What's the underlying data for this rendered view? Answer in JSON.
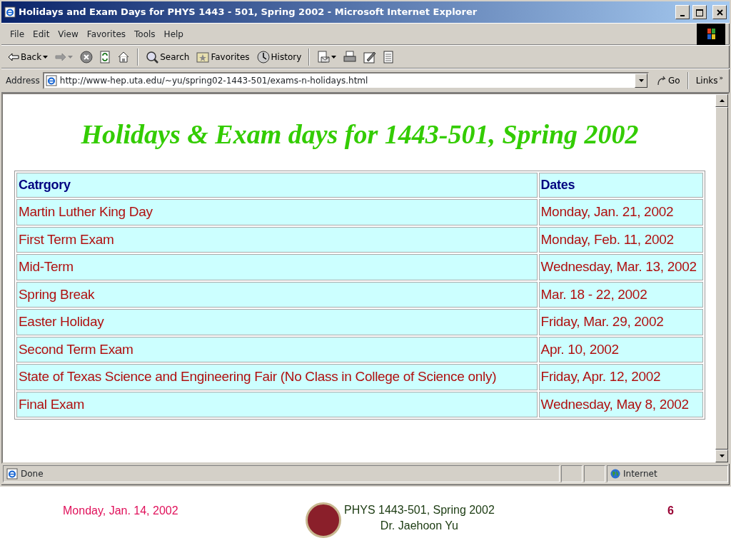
{
  "window": {
    "title": "Holidays and Exam Days for PHYS 1443 - 501, Spring 2002 - Microsoft Internet Explorer"
  },
  "menu": [
    "File",
    "Edit",
    "View",
    "Favorites",
    "Tools",
    "Help"
  ],
  "toolbar": [
    {
      "kind": "labeled",
      "label": "Back",
      "dropdown": true
    },
    {
      "kind": "icon",
      "dropdown": true
    },
    {
      "kind": "icon",
      "dropdown": false
    },
    {
      "kind": "icon",
      "dropdown": false
    },
    {
      "kind": "icon",
      "dropdown": false
    },
    {
      "kind": "separator"
    },
    {
      "kind": "labeled",
      "label": "Search",
      "dropdown": false
    },
    {
      "kind": "labeled",
      "label": "Favorites",
      "dropdown": false
    },
    {
      "kind": "labeled",
      "label": "History",
      "dropdown": false
    },
    {
      "kind": "separator"
    },
    {
      "kind": "icon",
      "dropdown": true
    },
    {
      "kind": "icon",
      "dropdown": false
    },
    {
      "kind": "icon",
      "dropdown": false
    },
    {
      "kind": "icon",
      "dropdown": false
    }
  ],
  "address_bar": {
    "label": "Address",
    "url": "http://www-hep.uta.edu/~yu/spring02-1443-501/exams-n-holidays.html",
    "go": "Go",
    "links": "Links",
    "more": "»"
  },
  "page": {
    "heading": "Holidays & Exam days for 1443-501, Spring 2002",
    "table": {
      "columns": [
        "Catrgory",
        "Dates"
      ],
      "rows": [
        [
          "Martin Luther King Day",
          "Monday, Jan. 21, 2002"
        ],
        [
          "First Term Exam",
          "Monday, Feb. 11, 2002"
        ],
        [
          "Mid-Term",
          "Wednesday, Mar. 13, 2002"
        ],
        [
          "Spring Break",
          "Mar. 18 - 22, 2002"
        ],
        [
          "Easter Holiday",
          "Friday, Mar. 29, 2002"
        ],
        [
          "Second Term Exam",
          "Apr. 10, 2002"
        ],
        [
          "State of Texas Science and Engineering Fair (No Class in College of Science only)",
          "Friday, Apr. 12, 2002"
        ],
        [
          "Final Exam",
          "Wednesday, May 8, 2002"
        ]
      ]
    }
  },
  "status_bar": {
    "text": "Done",
    "zone": "Internet"
  },
  "slide_footer": {
    "date": "Monday, Jan. 14, 2002",
    "course": "PHYS 1443-501, Spring 2002",
    "instructor": "Dr. Jaehoon Yu",
    "page_number": "6"
  }
}
